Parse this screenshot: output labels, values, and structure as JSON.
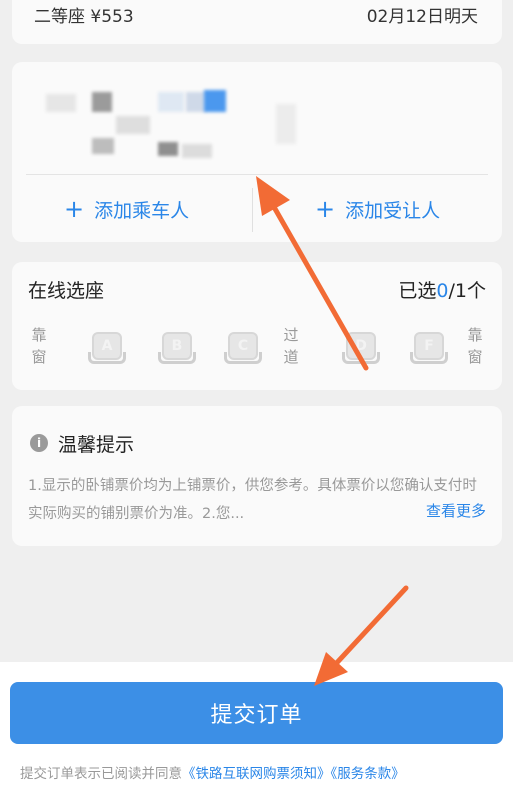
{
  "ticket": {
    "seat_class": "二等座 ¥553",
    "date": "02月12日明天"
  },
  "passenger": {
    "add_passenger": "添加乘车人",
    "add_concession": "添加受让人"
  },
  "seat_selection": {
    "title": "在线选座",
    "count_prefix": "已选",
    "count_selected": "0",
    "count_suffix": "/1个",
    "window_label": "靠窗",
    "aisle_label": "过道",
    "seats": [
      "A",
      "B",
      "C",
      "D",
      "F"
    ]
  },
  "tips": {
    "title": "温馨提示",
    "text": "1.显示的卧铺票价均为上铺票价，供您参考。具体票价以您确认支付时实际购买的铺别票价为准。2.您...",
    "more": "查看更多"
  },
  "submit": {
    "label": "提交订单"
  },
  "agreement": {
    "prefix": "提交订单表示已阅读并同意",
    "link1": "《铁路互联网购票须知》",
    "link2": "《服务条款》"
  },
  "colors": {
    "accent": "#2a86e8",
    "button": "#3c8fe6",
    "arrow": "#f26b35"
  }
}
